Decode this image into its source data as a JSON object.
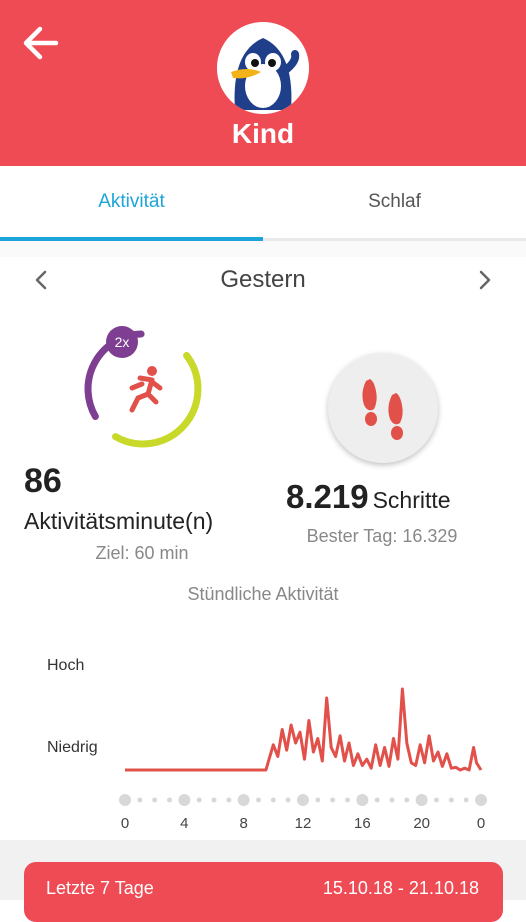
{
  "header": {
    "profile_name": "Kind",
    "back_icon": "arrow-left-icon",
    "avatar_icon": "penguin-avatar",
    "background_color": "#ee4b55"
  },
  "tabs": [
    {
      "label": "Aktivität",
      "active": true
    },
    {
      "label": "Schlaf",
      "active": false
    }
  ],
  "date_nav": {
    "label": "Gestern",
    "prev_icon": "chevron-left-icon",
    "next_icon": "chevron-right-icon"
  },
  "activity": {
    "multiplier_badge": "2x",
    "value": "86",
    "label": "Aktivitätsminute(n)",
    "goal": "Ziel: 60 min",
    "progress": 0.75,
    "icon": "running-person-icon"
  },
  "steps": {
    "value": "8.219",
    "unit": "Schritte",
    "best_day": "Bester Tag: 16.329",
    "icon": "footprints-icon"
  },
  "hourly": {
    "title": "Stündliche Aktivität",
    "y_high": "Hoch",
    "y_low": "Niedrig",
    "x_labels": [
      "0",
      "4",
      "8",
      "12",
      "16",
      "20",
      "0"
    ]
  },
  "chart_data": {
    "type": "line",
    "title": "Stündliche Aktivität",
    "xlabel": "",
    "ylabel": "",
    "x_tick_labels": [
      "0",
      "4",
      "8",
      "12",
      "16",
      "20",
      "0"
    ],
    "y_tick_labels": [
      "Niedrig",
      "Hoch"
    ],
    "xlim": [
      0,
      24
    ],
    "ylim": [
      0,
      1
    ],
    "color": "#e2504a",
    "x": [
      0,
      9.5,
      10.0,
      10.3,
      10.6,
      10.9,
      11.2,
      11.5,
      11.8,
      12.1,
      12.4,
      12.7,
      13.0,
      13.3,
      13.6,
      13.9,
      14.2,
      14.5,
      14.8,
      15.1,
      15.4,
      15.7,
      16.0,
      16.3,
      16.6,
      16.9,
      17.2,
      17.5,
      17.8,
      18.1,
      18.4,
      18.7,
      19.0,
      19.3,
      19.6,
      19.9,
      20.2,
      20.5,
      20.8,
      21.1,
      21.4,
      21.7,
      22.0,
      22.3,
      22.6,
      22.9,
      23.2,
      23.5,
      23.7,
      24.0
    ],
    "y": [
      0,
      0,
      0.28,
      0.15,
      0.45,
      0.22,
      0.5,
      0.3,
      0.42,
      0.12,
      0.55,
      0.2,
      0.35,
      0.1,
      0.8,
      0.25,
      0.15,
      0.38,
      0.1,
      0.3,
      0.05,
      0.18,
      0.05,
      0.12,
      0.02,
      0.28,
      0.05,
      0.25,
      0.04,
      0.35,
      0.12,
      0.9,
      0.3,
      0.08,
      0.05,
      0.28,
      0.08,
      0.38,
      0.1,
      0.2,
      0.04,
      0.18,
      0.02,
      0.03,
      0.0,
      0.02,
      0.0,
      0.25,
      0.08,
      0.0
    ]
  },
  "week": {
    "label": "Letzte 7 Tage",
    "range": "15.10.18 - 21.10.18"
  },
  "colors": {
    "accent": "#1da4d8",
    "brand": "#ee4b55",
    "ring_purple": "#7e3f92",
    "ring_green": "#c8d92a",
    "runner": "#e2504a"
  }
}
